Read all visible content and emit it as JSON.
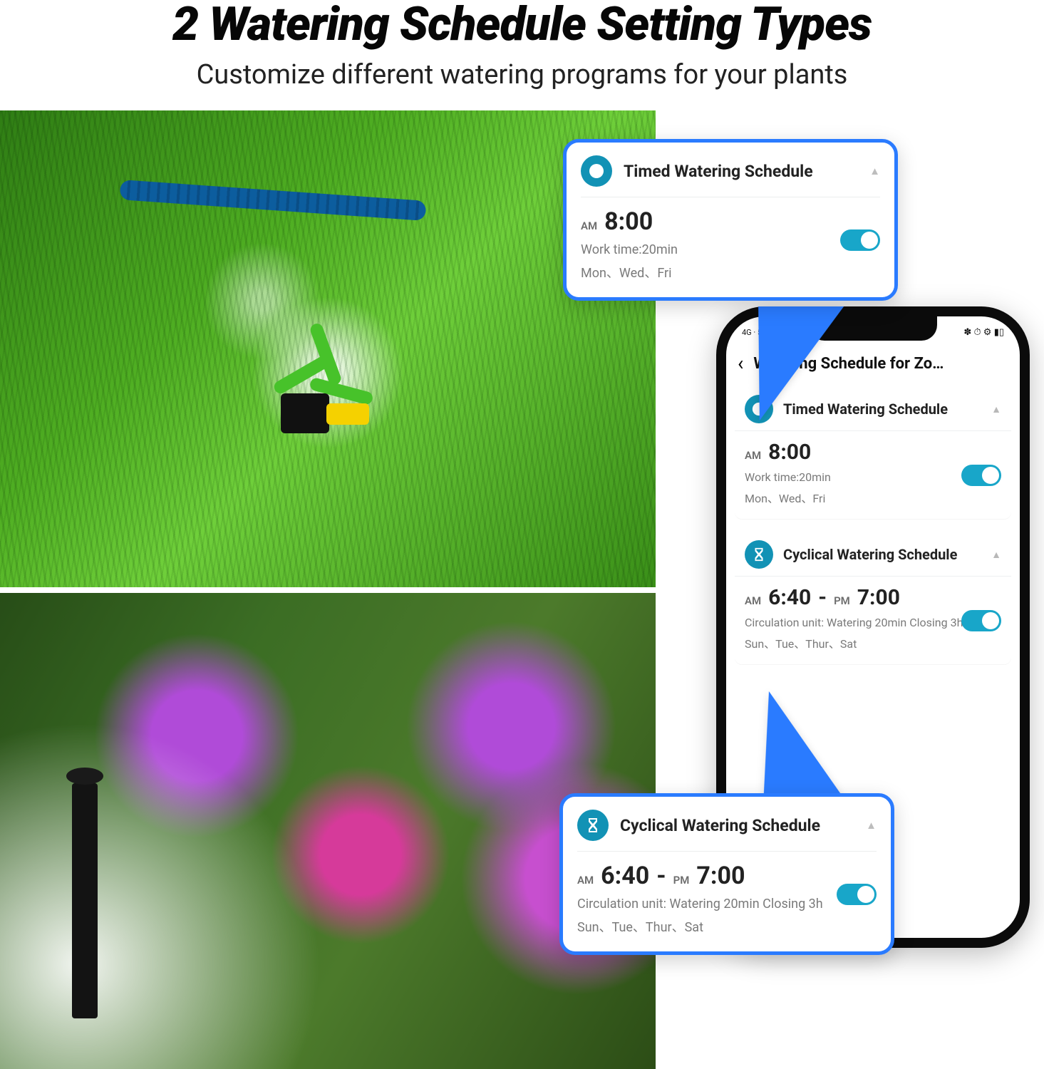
{
  "headline": {
    "title": "2 Watering Schedule Setting Types",
    "subtitle": "Customize different watering programs for your plants"
  },
  "phone": {
    "statusbar": {
      "left_indicators": "4G · 5G · ▦ · ✉ · ᯤ",
      "right_indicators": "✽ ⏱ ⚙ ▮▯"
    },
    "nav": {
      "back_glyph": "‹",
      "title": "Watering Schedule for Zo…"
    },
    "timed": {
      "label": "Timed Watering Schedule",
      "ampm": "AM",
      "time": "8:00",
      "work_time": "Work time:20min",
      "days": "Mon、Wed、Fri",
      "toggle_on": true
    },
    "cyclic": {
      "label": "Cyclical Watering Schedule",
      "start_ampm": "AM",
      "start_time": "6:40",
      "dash": "-",
      "end_ampm": "PM",
      "end_time": "7:00",
      "circ_line": "Circulation unit: Watering 20min Closing 3h",
      "days": "Sun、Tue、Thur、Sat",
      "toggle_on": true
    }
  },
  "callout_timed": {
    "label": "Timed Watering Schedule",
    "ampm": "AM",
    "time": "8:00",
    "work_time": "Work time:20min",
    "days": "Mon、Wed、Fri",
    "toggle_on": true
  },
  "callout_cyclic": {
    "label": "Cyclical Watering Schedule",
    "start_ampm": "AM",
    "start_time": "6:40",
    "dash": "-",
    "end_ampm": "PM",
    "end_time": "7:00",
    "circ_line": "Circulation unit: Watering 20min Closing 3h",
    "days": "Sun、Tue、Thur、Sat",
    "toggle_on": true
  }
}
